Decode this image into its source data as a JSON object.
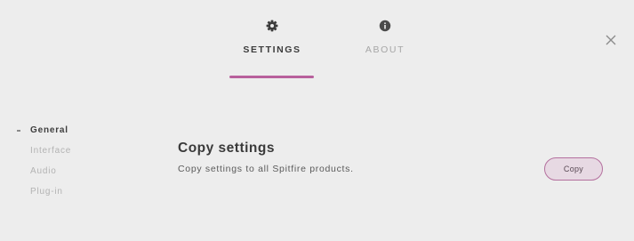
{
  "tabs": [
    {
      "label": "SETTINGS",
      "icon": "gear-icon",
      "active": true
    },
    {
      "label": "ABOUT",
      "icon": "info-icon",
      "active": false
    }
  ],
  "close": {
    "icon": "close-icon"
  },
  "sidebar": {
    "items": [
      {
        "label": "General",
        "active": true
      },
      {
        "label": "Interface",
        "active": false
      },
      {
        "label": "Audio",
        "active": false
      },
      {
        "label": "Plug-in",
        "active": false
      }
    ]
  },
  "section": {
    "title": "Copy settings",
    "description": "Copy settings to all Spitfire products.",
    "button_label": "Copy"
  },
  "colors": {
    "background": "#ededed",
    "accent": "#b8609c",
    "button_fill": "#e7d9e3",
    "text_primary": "#3a3a3a",
    "text_muted": "#b3b3b3"
  }
}
